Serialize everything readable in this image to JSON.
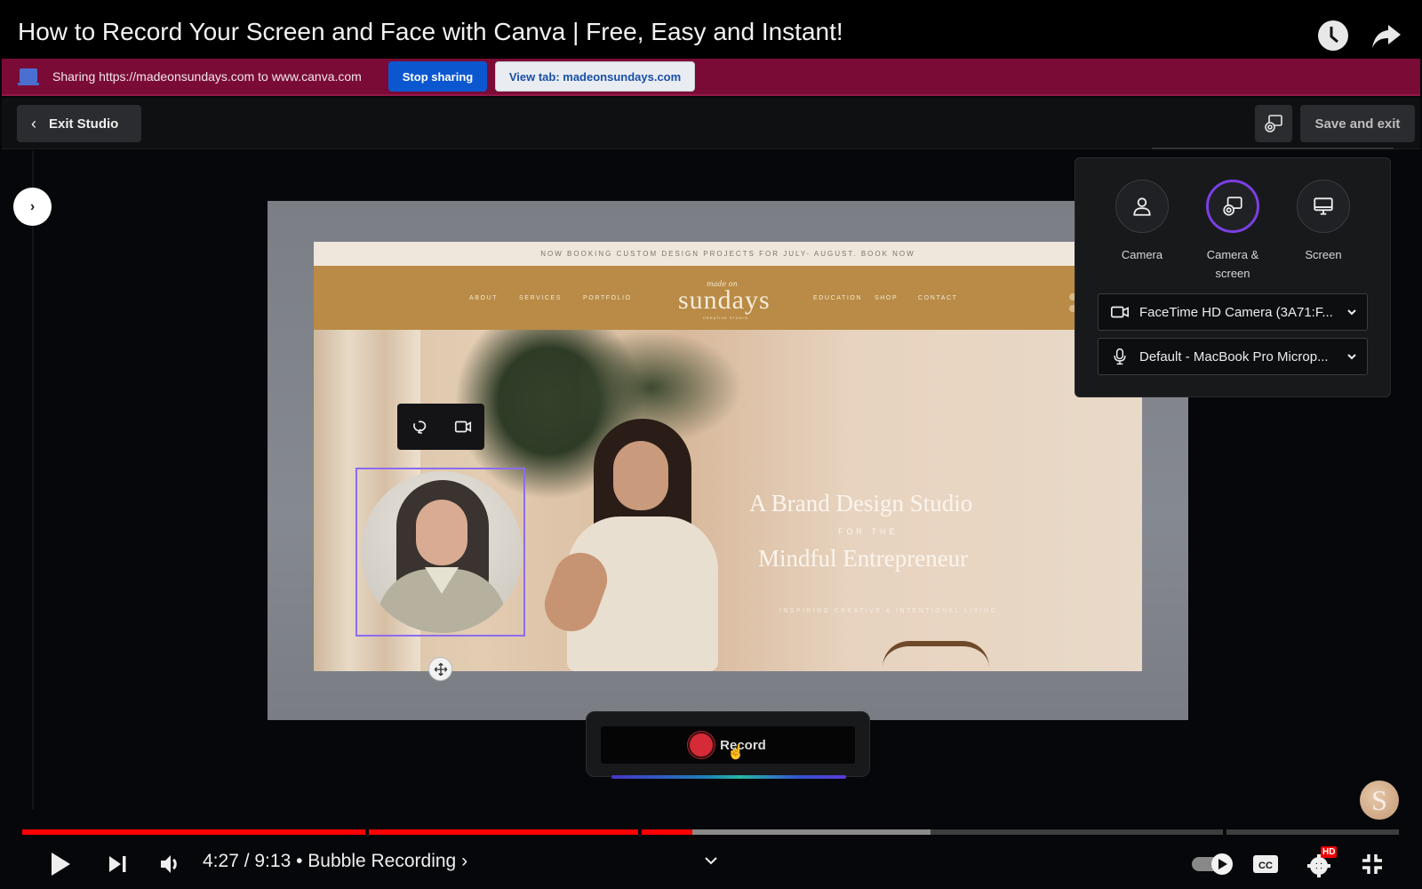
{
  "video": {
    "title": "How to Record Your Screen and Face with Canva | Free, Easy and Instant!",
    "watch_later_icon": "clock-icon",
    "share_icon": "share-arrow-icon"
  },
  "sharing_bar": {
    "text": "Sharing https://madeonsundays.com to www.canva.com",
    "stop_label": "Stop sharing",
    "view_tab_label": "View tab: madeonsundays.com",
    "accent": "#7a0b36"
  },
  "studio_header": {
    "exit_label": "Exit Studio",
    "save_label": "Save and exit"
  },
  "recording_panel": {
    "modes": [
      {
        "label": "Camera",
        "icon": "person-icon",
        "selected": false
      },
      {
        "label": "Camera & screen",
        "label_line1": "Camera &",
        "label_line2": "screen",
        "icon": "camera-screen-icon",
        "selected": true
      },
      {
        "label": "Screen",
        "icon": "monitor-icon",
        "selected": false
      }
    ],
    "camera_select": "FaceTime HD Camera (3A71:F...",
    "microphone_select": "Default - MacBook Pro Microp...",
    "selected_color": "#7a3fe4"
  },
  "website": {
    "banner": "NOW BOOKING CUSTOM DESIGN PROJECTS FOR JULY- AUGUST. BOOK NOW",
    "nav_left": [
      "ABOUT",
      "SERVICES",
      "PORTFOLIO"
    ],
    "nav_right": [
      "EDUCATION",
      "SHOP",
      "CONTACT"
    ],
    "logo_script": "made on",
    "logo": "sundays",
    "logo_sub": "CREATIVE STUDIO",
    "hero_line1": "A Brand Design Studio",
    "hero_line2": "FOR THE",
    "hero_line3": "Mindful Entrepreneur",
    "hero_tagline": "INSPIRING CREATIVE & INTENTIONAL LIVING",
    "brand_color": "#b98b46"
  },
  "record": {
    "label": "Record",
    "dot_color": "#d42b36"
  },
  "channel_avatar": "S",
  "player": {
    "current_time": "4:27",
    "duration": "9:13",
    "time_display": "4:27 / 9:13",
    "separator": "•",
    "chapter": "Bubble Recording ›",
    "progress_fraction": 0.4868,
    "buffered_fraction": 0.66,
    "chapter_breaks_fraction": [
      0.2505,
      0.4484,
      0.8737
    ],
    "hd_badge": "HD",
    "played_color": "#ff0000"
  }
}
